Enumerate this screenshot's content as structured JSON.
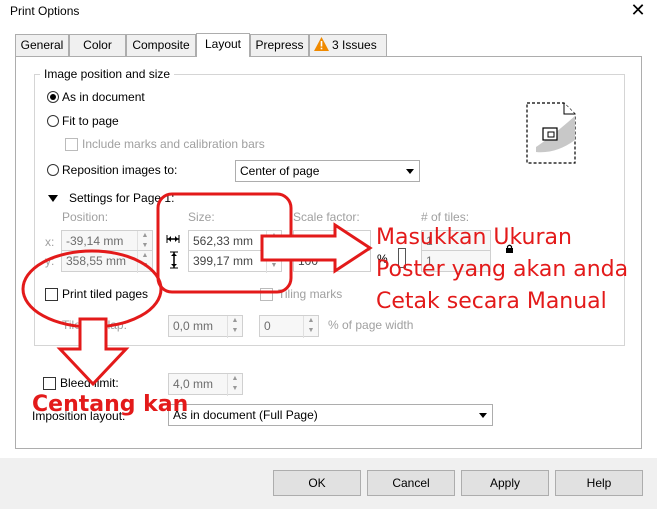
{
  "window": {
    "title": "Print Options"
  },
  "tabs": [
    {
      "label": "General"
    },
    {
      "label": "Color"
    },
    {
      "label": "Composite"
    },
    {
      "label": "Layout"
    },
    {
      "label": "Prepress"
    },
    {
      "label": "3 Issues"
    }
  ],
  "group": {
    "caption": "Image position and size",
    "radio_as_in_document": "As in document",
    "radio_fit_to_page": "Fit to page",
    "chk_include_marks": "Include marks and calibration bars",
    "radio_reposition": "Reposition images to:",
    "reposition_value": "Center of page",
    "settings_for_page": "Settings for Page 1:",
    "position_label": "Position:",
    "size_label": "Size:",
    "scale_label": "Scale factor:",
    "tiles_label": "# of tiles:",
    "x_label": "x:",
    "y_label": "y:",
    "pos_x": "-39,14 mm",
    "pos_y": "358,55 mm",
    "size_w": "562,33 mm",
    "size_h": "399,17 mm",
    "scale_x": "100",
    "scale_y": "100",
    "percent": "%",
    "tiles_x": "1",
    "tiles_y": "1",
    "print_tiled": "Print tiled pages",
    "tiling_marks": "Tiling marks",
    "tile_overlap": "Tile overlap:",
    "overlap_value": "0,0 mm",
    "page_width_value": "0",
    "page_width_label": "% of page width"
  },
  "bleed": {
    "label": "Bleed limit:",
    "value": "4,0 mm"
  },
  "imposition": {
    "label": "Imposition layout:",
    "value": "As in document (Full Page)"
  },
  "buttons": {
    "ok": "OK",
    "cancel": "Cancel",
    "apply": "Apply",
    "help": "Help"
  },
  "annotations": {
    "line1": "Masukkan Ukuran",
    "line2": "Poster yang akan anda",
    "line3": "Cetak secara Manual",
    "centang": "Centang kan"
  },
  "colors": {
    "annotation": "#e31a1a",
    "panel_border": "#adadad"
  }
}
